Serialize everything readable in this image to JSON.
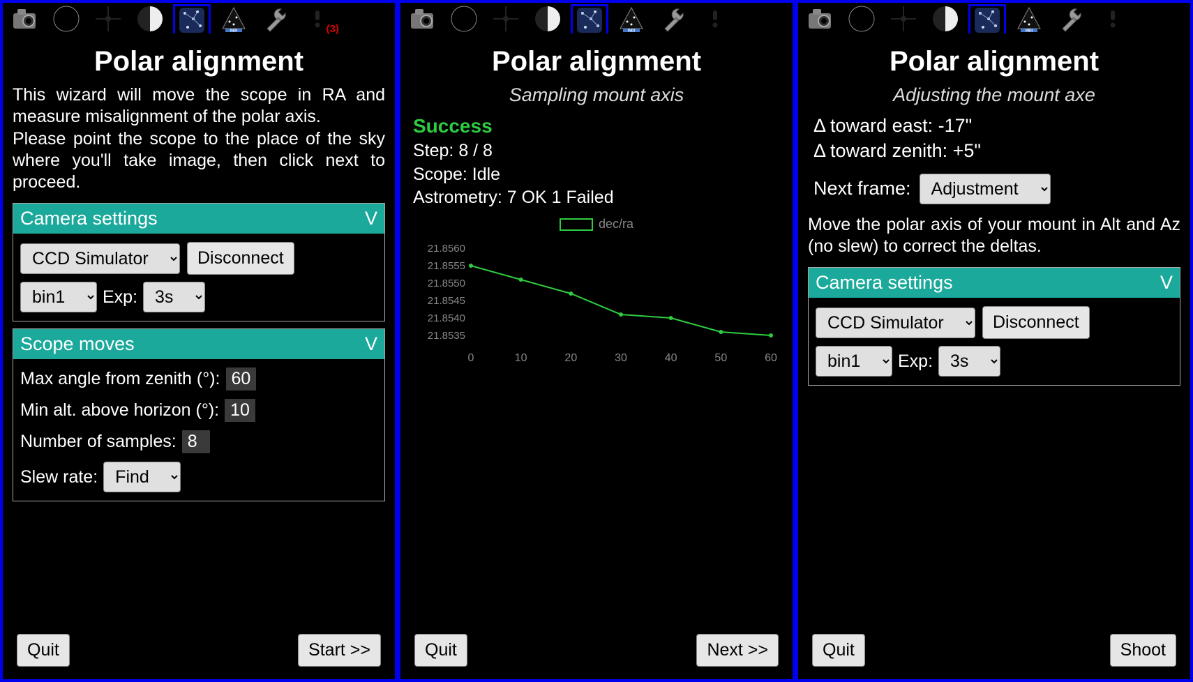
{
  "tabs": {
    "badge": "(3)"
  },
  "pane1": {
    "title": "Polar alignment",
    "intro1": "This wizard will move the scope in RA and measure misalignment of the polar axis.",
    "intro2": "Please point the scope to the place of the sky where you'll take image, then click next to proceed.",
    "cam_header": "Camera settings",
    "caret": "V",
    "camera": "CCD Simulator",
    "disconnect": "Disconnect",
    "bin": "bin1",
    "exp_label": "Exp:",
    "exp": "3s",
    "scope_header": "Scope moves",
    "max_angle_label": "Max angle from zenith (°):",
    "max_angle": "60",
    "min_alt_label": "Min alt. above horizon (°):",
    "min_alt": "10",
    "samples_label": "Number of samples:",
    "samples": "8",
    "slew_label": "Slew rate:",
    "slew": "Find",
    "quit": "Quit",
    "start": "Start >>"
  },
  "pane2": {
    "title": "Polar alignment",
    "subtitle": "Sampling mount axis",
    "success": "Success",
    "step": "Step: 8 / 8",
    "scope": "Scope: Idle",
    "astrometry": "Astrometry:  7 OK 1 Failed",
    "legend": "dec/ra",
    "quit": "Quit",
    "next": "Next >>"
  },
  "pane3": {
    "title": "Polar alignment",
    "subtitle": "Adjusting the mount axe",
    "delta_east": "Δ toward east: -17\"",
    "delta_zenith": "Δ toward zenith: +5\"",
    "nextframe_label": "Next frame:",
    "nextframe": "Adjustment",
    "instr": "Move the polar axis of your mount in Alt and Az (no slew) to correct the deltas.",
    "cam_header": "Camera settings",
    "caret": "V",
    "camera": "CCD Simulator",
    "disconnect": "Disconnect",
    "bin": "bin1",
    "exp_label": "Exp:",
    "exp": "3s",
    "quit": "Quit",
    "shoot": "Shoot"
  },
  "chart_data": {
    "type": "line",
    "series": [
      {
        "name": "dec/ra",
        "x": [
          0,
          10,
          20,
          30,
          40,
          50,
          60
        ],
        "y": [
          21.8555,
          21.8551,
          21.8547,
          21.8541,
          21.854,
          21.8536,
          21.8535
        ]
      }
    ],
    "yticks": [
      "21.8560",
      "21.8555",
      "21.8550",
      "21.8545",
      "21.8540",
      "21.8535"
    ],
    "xticks": [
      "0",
      "10",
      "20",
      "30",
      "40",
      "50",
      "60"
    ],
    "ylim": [
      21.8532,
      21.8562
    ],
    "xlabel": "",
    "ylabel": "",
    "title": ""
  }
}
